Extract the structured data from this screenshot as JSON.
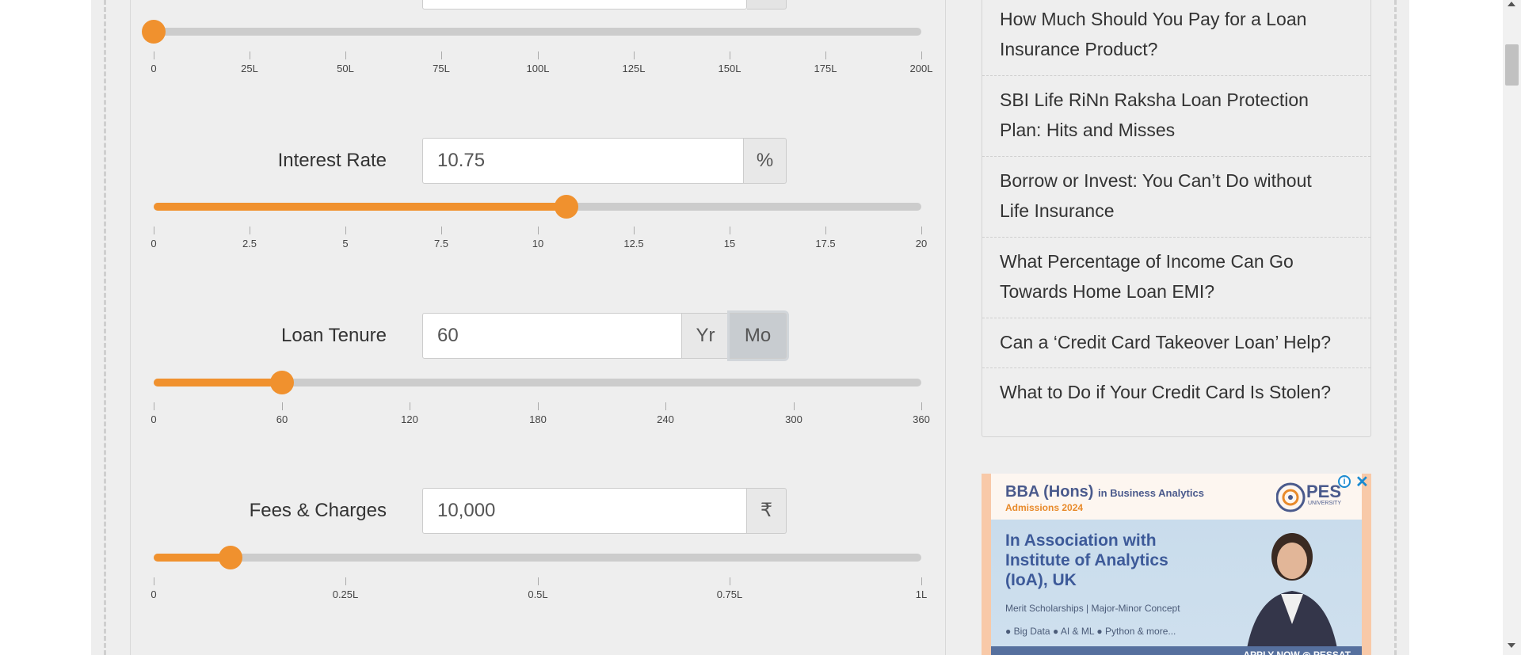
{
  "calculator": {
    "loan_amount": {
      "slider_value_lakh": 10,
      "slider_min": 0,
      "slider_max": 200,
      "ticks": [
        "0",
        "25L",
        "50L",
        "75L",
        "100L",
        "125L",
        "150L",
        "175L",
        "200L"
      ]
    },
    "interest_rate": {
      "label": "Interest Rate",
      "value": "10.75",
      "unit": "%",
      "slider_value": 10.75,
      "slider_min": 0,
      "slider_max": 20,
      "ticks": [
        "0",
        "2.5",
        "5",
        "7.5",
        "10",
        "12.5",
        "15",
        "17.5",
        "20"
      ]
    },
    "loan_tenure": {
      "label": "Loan Tenure",
      "value": "60",
      "unit_year": "Yr",
      "unit_month": "Mo",
      "selected_unit": "Mo",
      "slider_value": 60,
      "slider_min": 0,
      "slider_max": 360,
      "ticks": [
        "0",
        "60",
        "120",
        "180",
        "240",
        "300",
        "360"
      ]
    },
    "fees_charges": {
      "label": "Fees & Charges",
      "value": "10,000",
      "unit": "₹",
      "slider_value": 0.1,
      "slider_min": 0,
      "slider_max": 1,
      "ticks": [
        "0",
        "0.25L",
        "0.5L",
        "0.75L",
        "1L"
      ]
    }
  },
  "sidebar": {
    "articles": [
      {
        "line1": "How Much Should You Pay for a Loan",
        "line2": "Insurance Product?"
      },
      {
        "line1": "SBI Life RiNn Raksha Loan Protection",
        "line2": "Plan: Hits and Misses"
      },
      {
        "line1": "Borrow or Invest: You Can’t Do without",
        "line2": "Life Insurance"
      },
      {
        "line1": "What Percentage of Income Can Go",
        "line2": "Towards Home Loan EMI?"
      },
      {
        "line1": "Can a ‘Credit Card Takeover Loan’ Help?",
        "line2": ""
      },
      {
        "line1": "What to Do if Your Credit Card Is Stolen?",
        "line2": ""
      }
    ]
  },
  "ad": {
    "title": "BBA (Hons)",
    "title_suffix": "in Business Analytics",
    "admissions": "Admissions 2024",
    "logo_text": "PES",
    "logo_sub": "UNIVERSITY",
    "headline": "In Association with Institute of Analytics (IoA), UK",
    "merit": "Merit Scholarships | Major-Minor Concept",
    "bullets": "● Big Data  ● AI & ML  ● Python & more...",
    "footer": "APPLY NOW  ◎ PESSAT",
    "info_icon": "i",
    "close_icon": "✕"
  },
  "colors": {
    "accent": "#f0912e",
    "track": "#cccccc",
    "page_bg": "#eeeeee"
  }
}
